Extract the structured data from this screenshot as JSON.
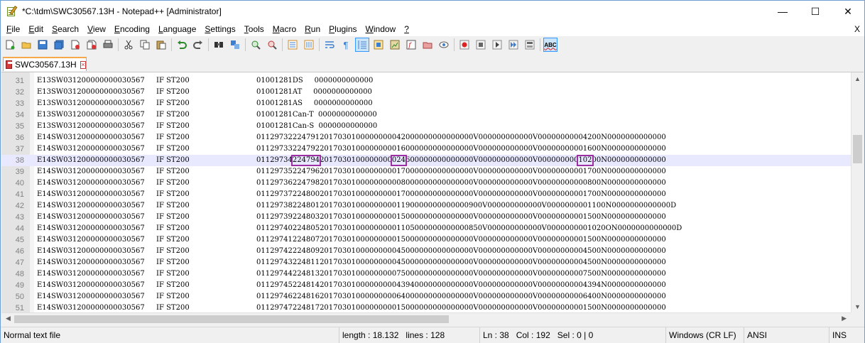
{
  "window": {
    "title": "*C:\\tdm\\SWC30567.13H - Notepad++ [Administrator]",
    "minimize_glyph": "—",
    "maximize_glyph": "☐",
    "close_glyph": "✕"
  },
  "menu": {
    "items": [
      {
        "acc": "F",
        "rest": "ile"
      },
      {
        "acc": "E",
        "rest": "dit"
      },
      {
        "acc": "S",
        "rest": "earch"
      },
      {
        "acc": "V",
        "rest": "iew"
      },
      {
        "acc": "E",
        "rest": "ncoding"
      },
      {
        "acc": "L",
        "rest": "anguage"
      },
      {
        "acc": "S",
        "rest": "ettings"
      },
      {
        "acc": "T",
        "rest": "ools"
      },
      {
        "acc": "M",
        "rest": "acro"
      },
      {
        "acc": "R",
        "rest": "un"
      },
      {
        "acc": "P",
        "rest": "lugins"
      },
      {
        "acc": "W",
        "rest": "indow"
      },
      {
        "acc": "?",
        "rest": ""
      }
    ],
    "doc_close": "X"
  },
  "toolbar": {
    "icons": [
      "new-file-icon",
      "open-file-icon",
      "save-icon",
      "save-all-icon",
      "close-icon",
      "close-all-icon",
      "print-icon",
      "cut-icon",
      "copy-icon",
      "paste-icon",
      "undo-icon",
      "redo-icon",
      "find-icon",
      "replace-icon",
      "zoom-in-icon",
      "zoom-out-icon",
      "sync-vertical-icon",
      "sync-horizontal-icon",
      "word-wrap-icon",
      "show-all-characters-icon",
      "indent-guide-icon",
      "user-defined-language-icon",
      "document-map-icon",
      "function-list-icon",
      "folder-as-workspace-icon",
      "monitoring-icon",
      "record-macro-icon",
      "stop-recording-icon",
      "playback-macro-icon",
      "run-macro-multiple-icon",
      "save-macro-icon",
      "spell-check-icon"
    ],
    "spell_label": "ABC"
  },
  "tab": {
    "label": "SWC30567.13H",
    "close_glyph": "×"
  },
  "editor": {
    "lines": [
      {
        "num": "31",
        "id": "E13SW031200000000030567",
        "cond": "IF ST200",
        "data": "01001281DS     0000000000000"
      },
      {
        "num": "32",
        "id": "E13SW031200000000030567",
        "cond": "IF ST200",
        "data": "01001281AT     0000000000000"
      },
      {
        "num": "33",
        "id": "E13SW031200000000030567",
        "cond": "IF ST200",
        "data": "01001281AS     0000000000000"
      },
      {
        "num": "34",
        "id": "E13SW031200000000030567",
        "cond": "IF ST200",
        "data": "01001281Can-T  0000000000000"
      },
      {
        "num": "35",
        "id": "E13SW031200000000030567",
        "cond": "IF ST200",
        "data": "01001281Can-S  0000000000000"
      },
      {
        "num": "36",
        "id": "E14SW031200000000030567",
        "cond": "IF ST200",
        "data": "011297322247912017030100000000042000000000000000V000000000000V00000000004200N0000000000000"
      },
      {
        "num": "37",
        "id": "E14SW031200000000030567",
        "cond": "IF ST200",
        "data": "011297332247922017030100000000016000000000000000V000000000000V00000000001600N0000000000000"
      },
      {
        "num": "38",
        "id": "E14SW031200000000030567",
        "cond": "IF ST200",
        "data": "011297342247942017030100000000024600000000000000V000000000000V00000000010200N0000000000000"
      },
      {
        "num": "39",
        "id": "E14SW031200000000030567",
        "cond": "IF ST200",
        "data": "011297352247962017030100000000017000000000000000V000000000000V00000000001700N0000000000000"
      },
      {
        "num": "40",
        "id": "E14SW031200000000030567",
        "cond": "IF ST200",
        "data": "011297362247982017030100000000008000000000000000V000000000000V00000000000800N0000000000000"
      },
      {
        "num": "41",
        "id": "E14SW031200000000030567",
        "cond": "IF ST200",
        "data": "011297372248002017030100000000017000000000000000V000000000000V00000000001700N0000000000000"
      },
      {
        "num": "42",
        "id": "E14SW031200000000030567",
        "cond": "IF ST200",
        "data": "01129738224801201703010000000001190000000000000900V000000000000V0000000001100N0000000000000D"
      },
      {
        "num": "43",
        "id": "E14SW031200000000030567",
        "cond": "IF ST200",
        "data": "011297392248032017030100000000015000000000000000V000000000000V00000000001500N0000000000000"
      },
      {
        "num": "44",
        "id": "E14SW031200000000030567",
        "cond": "IF ST200",
        "data": "01129740224805201703010000000001105000000000000850V000000000000V0000000001020ON0000000000000D"
      },
      {
        "num": "45",
        "id": "E14SW031200000000030567",
        "cond": "IF ST200",
        "data": "011297412248072017030100000000015000000000000000V000000000000V00000000001500N0000000000000"
      },
      {
        "num": "46",
        "id": "E14SW031200000000030567",
        "cond": "IF ST200",
        "data": "011297422248092017030100000000045000000000000000V000000000000V00000000004500N0000000000000"
      },
      {
        "num": "47",
        "id": "E14SW031200000000030567",
        "cond": "IF ST200",
        "data": "011297432248112017030100000000045000000000000000V000000000000V00000000004500N0000000000000"
      },
      {
        "num": "48",
        "id": "E14SW031200000000030567",
        "cond": "IF ST200",
        "data": "011297442248132017030100000000075000000000000000V000000000000V00000000007500N0000000000000"
      },
      {
        "num": "49",
        "id": "E14SW031200000000030567",
        "cond": "IF ST200",
        "data": "011297452248142017030100000000043940000000000000V000000000000V00000000004394N0000000000000"
      },
      {
        "num": "50",
        "id": "E14SW031200000000030567",
        "cond": "IF ST200",
        "data": "011297462248162017030100000000064000000000000000V000000000000V00000000006400N0000000000000"
      },
      {
        "num": "51",
        "id": "E14SW031200000000030567",
        "cond": "IF ST200",
        "data": "011297472248172017030100000000015000000000000000V000000000000V00000000001500N0000000000000"
      }
    ],
    "current_line": "38",
    "highlights": [
      "224794",
      "246",
      "102"
    ],
    "highlight_color": "#9b2fa3"
  },
  "status": {
    "file_type": "Normal text file",
    "length": "length : 18.132",
    "lines": "lines : 128",
    "ln": "Ln : 38",
    "col": "Col : 192",
    "sel": "Sel : 0 | 0",
    "eol": "Windows (CR LF)",
    "encoding": "ANSI",
    "mode": "INS"
  }
}
